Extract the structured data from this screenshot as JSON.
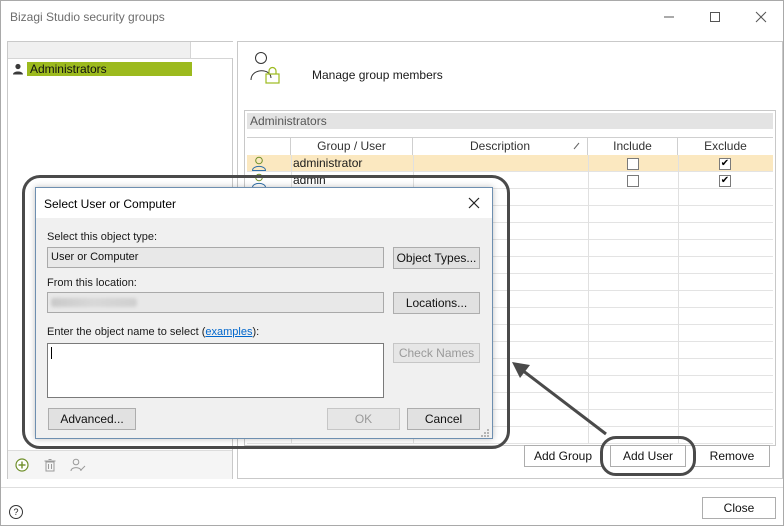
{
  "window": {
    "title": "Bizagi Studio security groups",
    "close_label": "Close",
    "help_glyph": "?"
  },
  "left_panel": {
    "tree_items": [
      {
        "label": "Administrators",
        "icon": "person-icon",
        "selected": true
      }
    ],
    "toolbar_icons": [
      "add-icon",
      "delete-icon",
      "user-edit-icon"
    ]
  },
  "right_panel": {
    "header_title": "Manage group members",
    "group_name": "Administrators",
    "columns": [
      "Group / User",
      "Description",
      "Include",
      "Exclude"
    ],
    "rows": [
      {
        "name": "administrator",
        "description": "",
        "include": false,
        "exclude": true,
        "selected": true
      },
      {
        "name": "admin",
        "description": "",
        "include": false,
        "exclude": true,
        "selected": false
      }
    ],
    "buttons": {
      "add_group": "Add Group",
      "add_user": "Add User",
      "remove": "Remove"
    }
  },
  "dialog": {
    "title": "Select User or Computer",
    "object_type_label": "Select this object type:",
    "object_type_value": "User or Computer",
    "object_types_button": "Object Types...",
    "location_label": "From this location:",
    "locations_button": "Locations...",
    "enter_label_prefix": "Enter the object name to select (",
    "enter_label_link": "examples",
    "enter_label_suffix": "):",
    "check_names_button": "Check Names",
    "advanced_button": "Advanced...",
    "ok_button": "OK",
    "cancel_button": "Cancel"
  },
  "colors": {
    "tree_selection": "#9cba1e",
    "row_selection": "#fbe8c0",
    "link": "#0066cc",
    "annotation": "#4a4a4a"
  }
}
